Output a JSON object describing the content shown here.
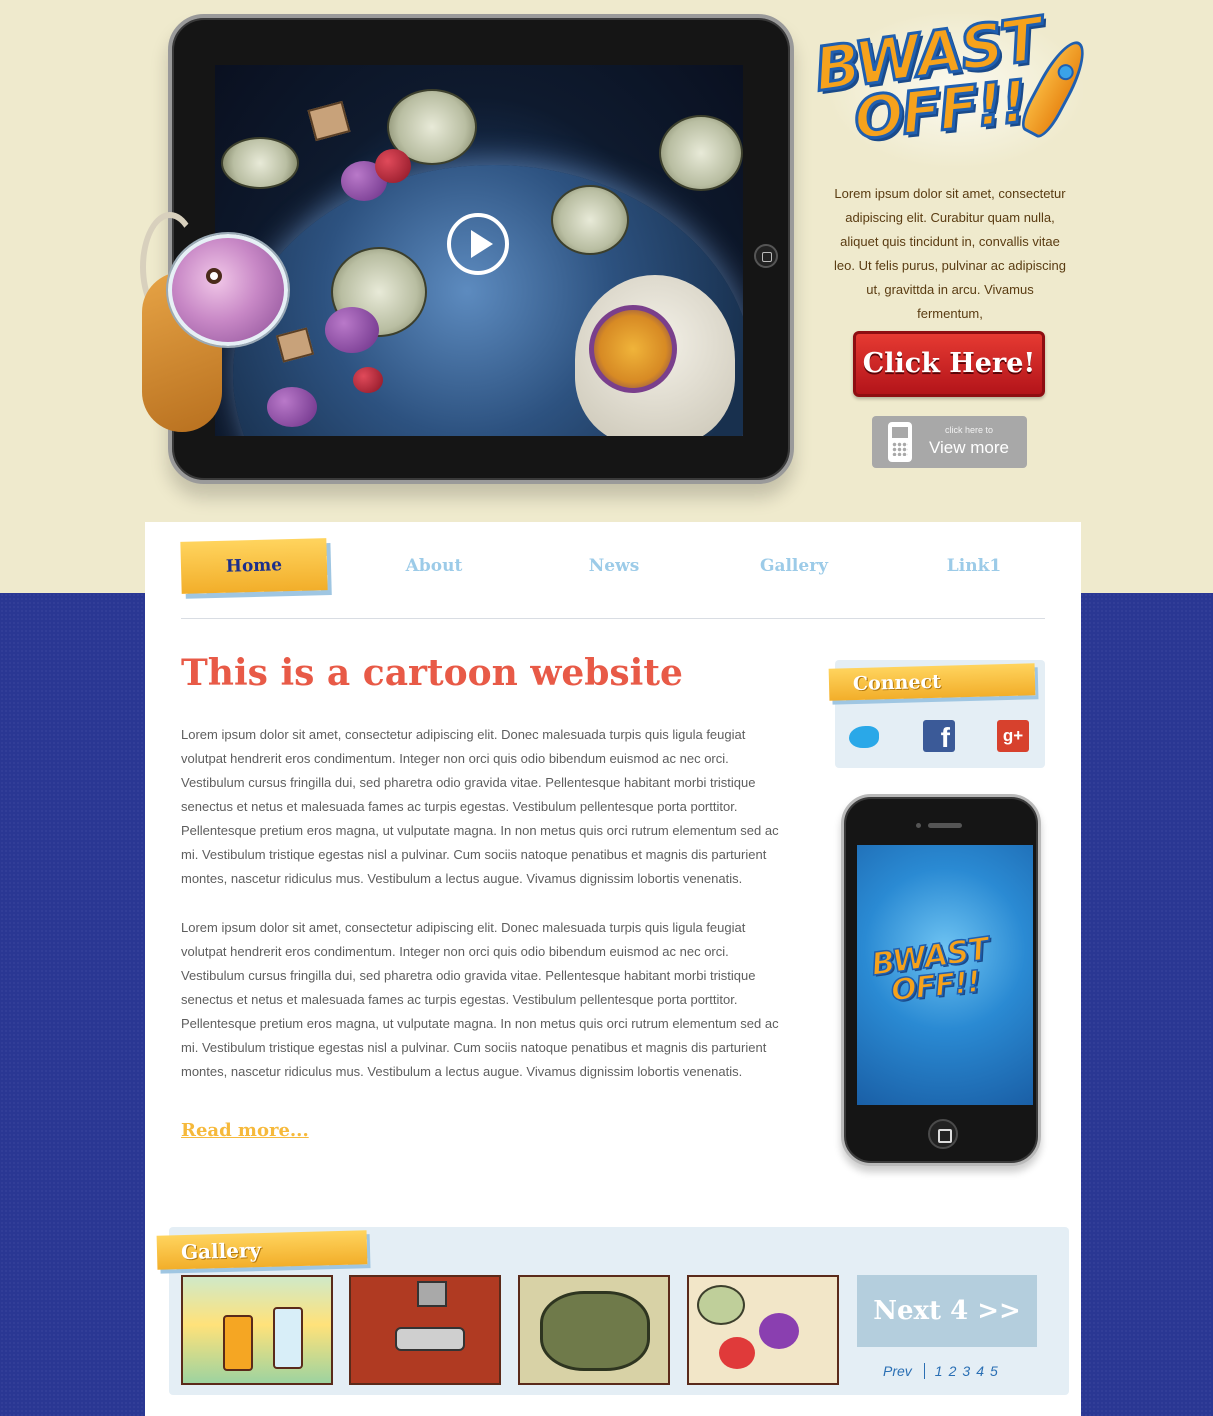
{
  "hero": {
    "description": "Lorem ipsum dolor sit amet, consectetur adipiscing elit. Curabitur quam nulla, aliquet quis tincidunt in, convallis vitae leo. Ut felis purus, pulvinar ac adipiscing ut, gravittda in arcu. Vivamus fermentum,",
    "click_button": "Click Here!",
    "view_more_small": "click here to",
    "view_more_label": "View more",
    "logo_line1": "BWAST",
    "logo_line2": "OFF!!"
  },
  "nav": {
    "items": [
      {
        "label": "Home",
        "active": true
      },
      {
        "label": "About",
        "active": false
      },
      {
        "label": "News",
        "active": false
      },
      {
        "label": "Gallery",
        "active": false
      },
      {
        "label": "Link1",
        "active": false
      }
    ]
  },
  "main": {
    "title": "This is a cartoon website",
    "paragraphs": [
      "Lorem ipsum dolor sit amet, consectetur adipiscing elit. Donec malesuada turpis quis ligula feugiat volutpat hendrerit eros condimentum. Integer non orci quis odio bibendum euismod ac nec orci. Vestibulum cursus fringilla dui, sed pharetra odio gravida vitae. Pellentesque habitant morbi tristique senectus et netus et malesuada fames ac turpis egestas. Vestibulum pellentesque porta porttitor. Pellentesque pretium eros magna, ut vulputate magna. In non metus quis orci rutrum elementum sed ac mi. Vestibulum tristique egestas nisl a pulvinar. Cum sociis natoque penatibus et magnis dis parturient montes, nascetur ridiculus mus. Vestibulum a lectus augue. Vivamus dignissim lobortis venenatis.",
      "Lorem ipsum dolor sit amet, consectetur adipiscing elit. Donec malesuada turpis quis ligula feugiat volutpat hendrerit eros condimentum. Integer non orci quis odio bibendum euismod ac nec orci. Vestibulum cursus fringilla dui, sed pharetra odio gravida vitae. Pellentesque habitant morbi tristique senectus et netus et malesuada fames ac turpis egestas. Vestibulum pellentesque porta porttitor. Pellentesque pretium eros magna, ut vulputate magna. In non metus quis orci rutrum elementum sed ac mi. Vestibulum tristique egestas nisl a pulvinar. Cum sociis natoque penatibus et magnis dis parturient montes, nascetur ridiculus mus. Vestibulum a lectus augue. Vivamus dignissim lobortis venenatis."
    ],
    "read_more": "Read more..."
  },
  "sidebar": {
    "connect_title": "Connect",
    "social": [
      {
        "name": "twitter-icon",
        "glyph": ""
      },
      {
        "name": "facebook-icon",
        "glyph": "f"
      },
      {
        "name": "google-plus-icon",
        "glyph": "g+"
      }
    ],
    "phone_logo_line1": "BWAST",
    "phone_logo_line2": "OFF!!"
  },
  "gallery": {
    "title": "Gallery",
    "next_button": "Next 4 >>",
    "pager": {
      "prev": "Prev",
      "pages": [
        "1",
        "2",
        "3",
        "4",
        "5"
      ]
    }
  },
  "colors": {
    "hero_bg": "#efeacd",
    "page_bg": "#2a3793",
    "accent_red": "#e85a47",
    "accent_yellow": "#f6b93b",
    "nav_inactive": "#9ccbe8",
    "click_button": "#d42a2a"
  }
}
